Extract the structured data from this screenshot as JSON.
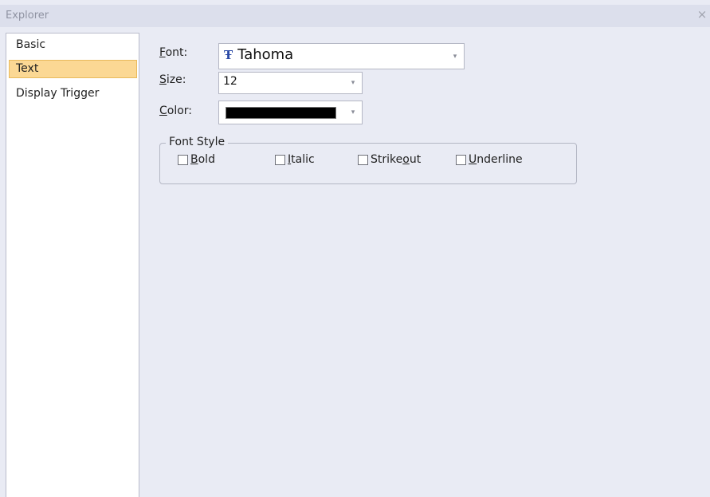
{
  "window": {
    "title": "Explorer",
    "close_glyph": "×"
  },
  "nav": {
    "items": [
      {
        "label": "Basic",
        "selected": false
      },
      {
        "label": "Text",
        "selected": true
      },
      {
        "label": "Display Trigger",
        "selected": false
      }
    ]
  },
  "text_props": {
    "font": {
      "label_mnemonic": "F",
      "label_rest": "ont:",
      "icon_glyph": "Ŧ",
      "value": "Tahoma"
    },
    "size": {
      "label_mnemonic": "S",
      "label_rest": "ize:",
      "value": "12"
    },
    "color": {
      "label_mnemonic": "C",
      "label_rest": "olor:",
      "value_hex": "#000000"
    },
    "dropdown_glyph": "▾",
    "font_style": {
      "legend": "Font Style",
      "options": [
        {
          "pre": "",
          "mnemonic": "B",
          "post": "old",
          "checked": false
        },
        {
          "pre": "",
          "mnemonic": "I",
          "post": "talic",
          "checked": false
        },
        {
          "pre": "Strike",
          "mnemonic": "o",
          "post": "ut",
          "checked": false
        },
        {
          "pre": "",
          "mnemonic": "U",
          "post": "nderline",
          "checked": false
        }
      ]
    }
  },
  "colors": {
    "background": "#e9ebf4",
    "selection": "#fbd894",
    "accent_icon": "#2b4aa6"
  }
}
